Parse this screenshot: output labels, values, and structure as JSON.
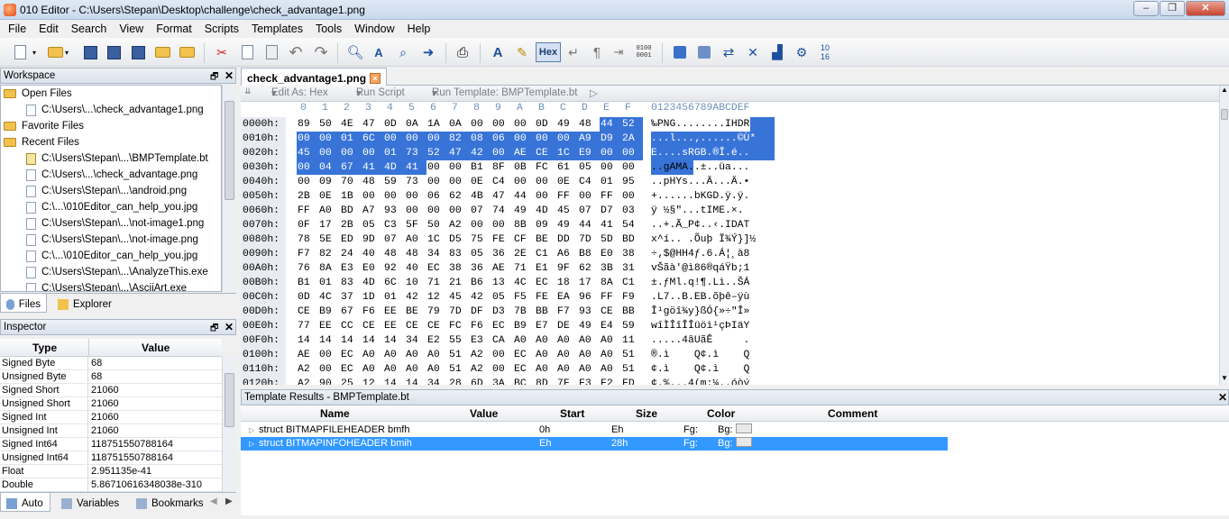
{
  "window": {
    "title": "010 Editor - C:\\Users\\Stepan\\Desktop\\challenge\\check_advantage1.png",
    "controls": [
      "–",
      "❐",
      "✕"
    ]
  },
  "menu": [
    "File",
    "Edit",
    "Search",
    "View",
    "Format",
    "Scripts",
    "Templates",
    "Tools",
    "Window",
    "Help"
  ],
  "toolbar": {
    "hex_label": "Hex",
    "bits_label": "0100\n0001",
    "icons": [
      "new-doc-icon",
      "open-folder-icon",
      "save-icon",
      "save-as-icon",
      "save-all-icon",
      "open-folder2-icon",
      "open-folder3-icon",
      "cut-icon",
      "copy-icon",
      "paste-icon",
      "undo-icon",
      "redo-icon",
      "find-icon",
      "find-replace-icon",
      "find-in-files-icon",
      "goto-icon",
      "print-icon",
      "font-icon",
      "highlight-icon",
      "hex-icon",
      "linefeed-icon",
      "pilcrow-icon",
      "bits-icon",
      "calculator-icon",
      "compare-icon",
      "sync-icon",
      "tools-icon",
      "histogram-icon",
      "template-icon",
      "base-convert-icon"
    ]
  },
  "workspace": {
    "title": "Workspace",
    "sections": {
      "open_files": "Open Files",
      "favorite_files": "Favorite Files",
      "recent_files": "Recent Files"
    },
    "open_files": [
      "C:\\Users\\...\\check_advantage1.png"
    ],
    "recent_files": [
      "C:\\Users\\Stepan\\...\\BMPTemplate.bt",
      "C:\\Users\\...\\check_advantage.png",
      "C:\\Users\\Stepan\\...\\android.png",
      "C:\\...\\010Editor_can_help_you.jpg",
      "C:\\Users\\Stepan\\...\\not-image1.png",
      "C:\\Users\\Stepan\\...\\not-image.png",
      "C:\\...\\010Editor_can_help_you.jpg",
      "C:\\Users\\Stepan\\...\\AnalyzeThis.exe",
      "C:\\Users\\Stepan\\...\\AsciiArt.exe"
    ],
    "tabs": [
      "Files",
      "Explorer"
    ]
  },
  "inspector": {
    "title": "Inspector",
    "col_type": "Type",
    "col_value": "Value",
    "rows": [
      {
        "type": "Signed Byte",
        "value": "68"
      },
      {
        "type": "Unsigned Byte",
        "value": "68"
      },
      {
        "type": "Signed Short",
        "value": "21060"
      },
      {
        "type": "Unsigned Short",
        "value": "21060"
      },
      {
        "type": "Signed Int",
        "value": "21060"
      },
      {
        "type": "Unsigned Int",
        "value": "21060"
      },
      {
        "type": "Signed Int64",
        "value": "118751550788164"
      },
      {
        "type": "Unsigned Int64",
        "value": "118751550788164"
      },
      {
        "type": "Float",
        "value": "2.951135e-41"
      },
      {
        "type": "Double",
        "value": "5.86710616348038e-310"
      }
    ],
    "tabs": [
      "Auto",
      "Variables",
      "Bookmarks"
    ]
  },
  "document": {
    "tab_label": "check_advantage1.png",
    "editbar": {
      "edit_as": "Edit As: Hex",
      "run_script": "Run Script",
      "run_template": "Run Template: BMPTemplate.bt"
    },
    "col_header": [
      "0",
      "1",
      "2",
      "3",
      "4",
      "5",
      "6",
      "7",
      "8",
      "9",
      "A",
      "B",
      "C",
      "D",
      "E",
      "F"
    ],
    "ascii_header": "0123456789ABCDEF",
    "rows": [
      {
        "addr": "0000h:",
        "bytes": [
          "89",
          "50",
          "4E",
          "47",
          "0D",
          "0A",
          "1A",
          "0A",
          "00",
          "00",
          "00",
          "0D",
          "49",
          "48",
          "44",
          "52"
        ],
        "ascii": "‰PNG........IHDR"
      },
      {
        "addr": "0010h:",
        "bytes": [
          "00",
          "00",
          "01",
          "6C",
          "00",
          "00",
          "00",
          "82",
          "08",
          "06",
          "00",
          "00",
          "00",
          "A9",
          "D9",
          "2A"
        ],
        "ascii": "...l...‚......©Ù*"
      },
      {
        "addr": "0020h:",
        "bytes": [
          "45",
          "00",
          "00",
          "00",
          "01",
          "73",
          "52",
          "47",
          "42",
          "00",
          "AE",
          "CE",
          "1C",
          "E9",
          "00",
          "00"
        ],
        "ascii": "E....sRGB.®Î.é.."
      },
      {
        "addr": "0030h:",
        "bytes": [
          "00",
          "04",
          "67",
          "41",
          "4D",
          "41",
          "00",
          "00",
          "B1",
          "8F",
          "0B",
          "FC",
          "61",
          "05",
          "00",
          "00"
        ],
        "ascii": "..gAMA..±..üa..."
      },
      {
        "addr": "0040h:",
        "bytes": [
          "00",
          "09",
          "70",
          "48",
          "59",
          "73",
          "00",
          "00",
          "0E",
          "C4",
          "00",
          "00",
          "0E",
          "C4",
          "01",
          "95"
        ],
        "ascii": "..pHYs...Ä...Ä.•"
      },
      {
        "addr": "0050h:",
        "bytes": [
          "2B",
          "0E",
          "1B",
          "00",
          "00",
          "00",
          "06",
          "62",
          "4B",
          "47",
          "44",
          "00",
          "FF",
          "00",
          "FF",
          "00"
        ],
        "ascii": "+......bKGD.ÿ.ÿ."
      },
      {
        "addr": "0060h:",
        "bytes": [
          "FF",
          "A0",
          "BD",
          "A7",
          "93",
          "00",
          "00",
          "00",
          "07",
          "74",
          "49",
          "4D",
          "45",
          "07",
          "D7",
          "03"
        ],
        "ascii": "ÿ ½§\"...tIME.×."
      },
      {
        "addr": "0070h:",
        "bytes": [
          "0F",
          "17",
          "2B",
          "05",
          "C3",
          "5F",
          "50",
          "A2",
          "00",
          "00",
          "8B",
          "09",
          "49",
          "44",
          "41",
          "54"
        ],
        "ascii": "..+.Ã_P¢..‹.IDAT"
      },
      {
        "addr": "0080h:",
        "bytes": [
          "78",
          "5E",
          "ED",
          "9D",
          "07",
          "A0",
          "1C",
          "D5",
          "75",
          "FE",
          "CF",
          "BE",
          "DD",
          "7D",
          "5D",
          "BD"
        ],
        "ascii": "x^í.. .Õuþ Ï¾Ý}]½"
      },
      {
        "addr": "0090h:",
        "bytes": [
          "F7",
          "82",
          "24",
          "40",
          "48",
          "48",
          "34",
          "83",
          "05",
          "36",
          "2E",
          "C1",
          "A6",
          "B8",
          "E0",
          "38"
        ],
        "ascii": "÷‚$@HH4ƒ.6.Á¦¸à8"
      },
      {
        "addr": "00A0h:",
        "bytes": [
          "76",
          "8A",
          "E3",
          "E0",
          "92",
          "40",
          "EC",
          "38",
          "36",
          "AE",
          "71",
          "E1",
          "9F",
          "62",
          "3B",
          "31"
        ],
        "ascii": "vŠãà'@ì86®qáŸb;1"
      },
      {
        "addr": "00B0h:",
        "bytes": [
          "B1",
          "01",
          "83",
          "4D",
          "6C",
          "10",
          "71",
          "21",
          "B6",
          "13",
          "4C",
          "EC",
          "18",
          "17",
          "8A",
          "C1"
        ],
        "ascii": "±.ƒMl.q!¶.Lì..ŠÁ"
      },
      {
        "addr": "00C0h:",
        "bytes": [
          "0D",
          "4C",
          "37",
          "1D",
          "01",
          "42",
          "12",
          "45",
          "42",
          "05",
          "F5",
          "FE",
          "EA",
          "96",
          "FF",
          "F9"
        ],
        "ascii": ".L7..B.EB.õþê–ÿù"
      },
      {
        "addr": "00D0h:",
        "bytes": [
          "CE",
          "B9",
          "67",
          "F6",
          "EE",
          "BE",
          "79",
          "7D",
          "DF",
          "D3",
          "7B",
          "BB",
          "F7",
          "93",
          "CE",
          "BB"
        ],
        "ascii": "Î¹göî¾y}ßÓ{»÷\"Î»"
      },
      {
        "addr": "00E0h:",
        "bytes": [
          "77",
          "EE",
          "CC",
          "CE",
          "EE",
          "CE",
          "CE",
          "FC",
          "F6",
          "EC",
          "B9",
          "E7",
          "DE",
          "49",
          "E4",
          "59"
        ],
        "ascii": "wîÌÎîÎÎüöì¹çÞIäY"
      },
      {
        "addr": "00F0h:",
        "bytes": [
          "14",
          "14",
          "14",
          "14",
          "14",
          "34",
          "E2",
          "55",
          "E3",
          "CA",
          "A0",
          "A0",
          "A0",
          "A0",
          "A0",
          "11"
        ],
        "ascii": ".....4âUãÊ     ."
      },
      {
        "addr": "0100h:",
        "bytes": [
          "AE",
          "00",
          "EC",
          "A0",
          "A0",
          "A0",
          "A0",
          "51",
          "A2",
          "00",
          "EC",
          "A0",
          "A0",
          "A0",
          "A0",
          "51"
        ],
        "ascii": "®.ì    Q¢.ì    Q"
      },
      {
        "addr": "0110h:",
        "bytes": [
          "A2",
          "00",
          "EC",
          "A0",
          "A0",
          "A0",
          "A0",
          "51",
          "A2",
          "00",
          "EC",
          "A0",
          "A0",
          "A0",
          "A0",
          "51"
        ],
        "ascii": "¢.ì    Q¢.ì    Q"
      },
      {
        "addr": "0120h:",
        "bytes": [
          "A2",
          "90",
          "25",
          "12",
          "14",
          "14",
          "34",
          "28",
          "6D",
          "3A",
          "BC",
          "8D",
          "7F",
          "F3",
          "F2",
          "FD"
        ],
        "ascii": "¢.%...4(m:¼..óòý"
      }
    ]
  },
  "template_results": {
    "title": "Template Results - BMPTemplate.bt",
    "columns": [
      "Name",
      "Value",
      "Start",
      "Size",
      "Color",
      "Comment"
    ],
    "rows": [
      {
        "name": "struct BITMAPFILEHEADER bmfh",
        "value": "",
        "start": "0h",
        "size": "Eh",
        "fg": "Fg:",
        "bg": "Bg:"
      },
      {
        "name": "struct BITMAPINFOHEADER bmih",
        "value": "",
        "start": "Eh",
        "size": "28h",
        "fg": "Fg:",
        "bg": "Bg:"
      }
    ]
  },
  "colors": {
    "selection": "#3874d8",
    "row_selected": "#3399ff",
    "hex_header": "#6b8fb8"
  }
}
